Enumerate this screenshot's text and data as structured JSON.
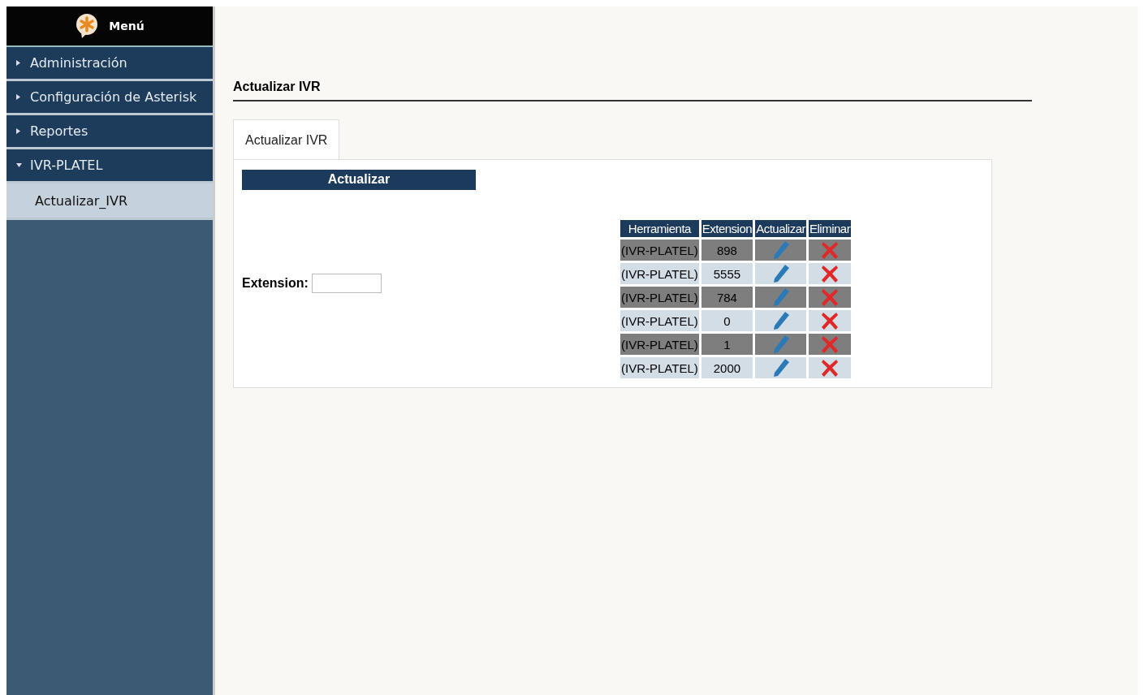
{
  "sidebar": {
    "title": "Menú",
    "items": [
      {
        "label": "Administración",
        "expanded": false
      },
      {
        "label": "Configuración de Asterisk",
        "expanded": false
      },
      {
        "label": "Reportes",
        "expanded": false
      },
      {
        "label": "IVR-PLATEL",
        "expanded": true,
        "children": [
          {
            "label": "Actualizar_IVR",
            "selected": true
          }
        ]
      }
    ]
  },
  "page": {
    "heading": "Actualizar IVR",
    "tabs": [
      {
        "label": "Actualizar IVR",
        "selected": true
      }
    ],
    "section_title": "Actualizar",
    "form": {
      "label": "Extension:"
    },
    "table": {
      "columns": [
        "Herramienta",
        "Extension",
        "Actualizar",
        "Eliminar"
      ],
      "rows": [
        {
          "tool": "(IVR-PLATEL)",
          "extension": "898"
        },
        {
          "tool": "(IVR-PLATEL)",
          "extension": "5555"
        },
        {
          "tool": "(IVR-PLATEL)",
          "extension": "784"
        },
        {
          "tool": "(IVR-PLATEL)",
          "extension": "0"
        },
        {
          "tool": "(IVR-PLATEL)",
          "extension": "1"
        },
        {
          "tool": "(IVR-PLATEL)",
          "extension": "2000"
        }
      ]
    }
  }
}
